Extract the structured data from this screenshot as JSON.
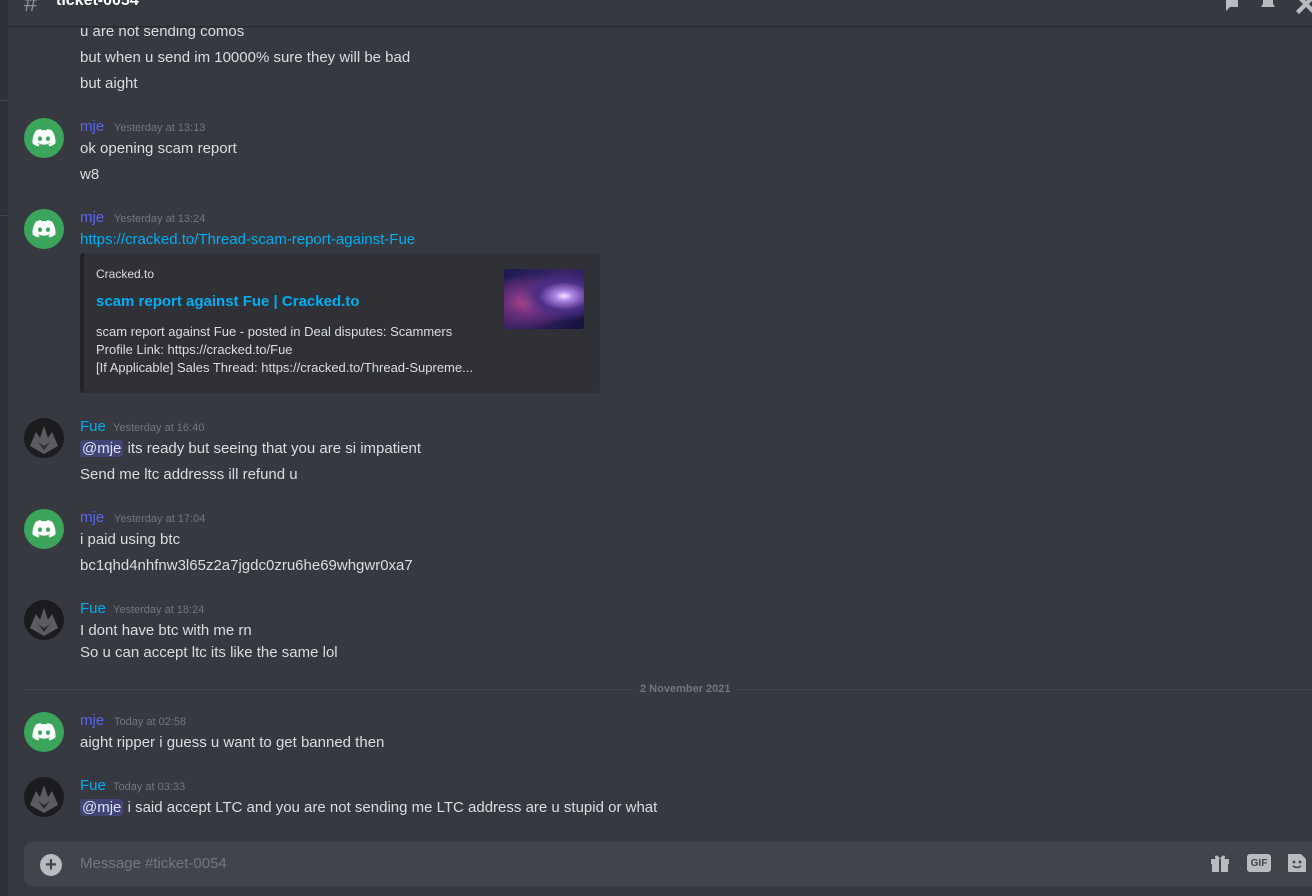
{
  "channel": {
    "name": "ticket-0054"
  },
  "icons": {
    "hash": "hash-icon",
    "threads": "threads-icon",
    "bell": "bell-icon",
    "close": "close-icon",
    "discord": "discord-logo-icon",
    "gift": "gift-icon",
    "sticker": "sticker-icon",
    "plus": "add-attachment-icon"
  },
  "colors": {
    "mje": "#5865f2",
    "fue": "#00aff4",
    "link": "#00aff4",
    "avatar_green": "#3ba55c"
  },
  "continuation": [
    "u are not sending comos",
    "but when u send im 10000% sure they will be bad",
    "but aight"
  ],
  "messages": [
    {
      "author": "mje",
      "timestamp": "Yesterday at 13:13",
      "lines": [
        "ok opening scam report",
        "w8"
      ]
    },
    {
      "author": "mje",
      "timestamp": "Yesterday at 13:24",
      "link": "https://cracked.to/Thread-scam-report-against-Fue",
      "embed": {
        "provider": "Cracked.to",
        "title": "scam report against Fue | Cracked.to",
        "desc": [
          "scam report against Fue - posted in Deal disputes: Scammers",
          "Profile Link: https://cracked.to/Fue",
          "[If Applicable] Sales Thread: https://cracked.to/Thread-Supreme..."
        ]
      }
    },
    {
      "author": "Fue",
      "timestamp": "Yesterday at 16:40",
      "mention": "@mje",
      "first_line_rest": " its ready but seeing that you are si impatient",
      "lines": [
        "Send me ltc addresss ill refund u"
      ]
    },
    {
      "author": "mje",
      "timestamp": "Yesterday at 17:04",
      "lines": [
        "i paid using btc",
        "bc1qhd4nhfnw3l65z2a7jgdc0zru6he69whgwr0xa7"
      ]
    },
    {
      "author": "Fue",
      "timestamp": "Yesterday at 18:24",
      "lines": [
        "I dont have btc with me rn",
        "So u can accept ltc its like the same lol"
      ]
    },
    {
      "author": "mje",
      "timestamp": "Today at 02:58",
      "lines": [
        "aight ripper i guess u want to get banned then"
      ]
    },
    {
      "author": "Fue",
      "timestamp": "Today at 03:33",
      "mention": "@mje",
      "first_line_rest": " i said accept LTC and you are not sending me LTC address are u stupid or what"
    }
  ],
  "date_divider": "2 November 2021",
  "composer": {
    "placeholder": "Message #ticket-0054",
    "gif_label": "GIF"
  }
}
